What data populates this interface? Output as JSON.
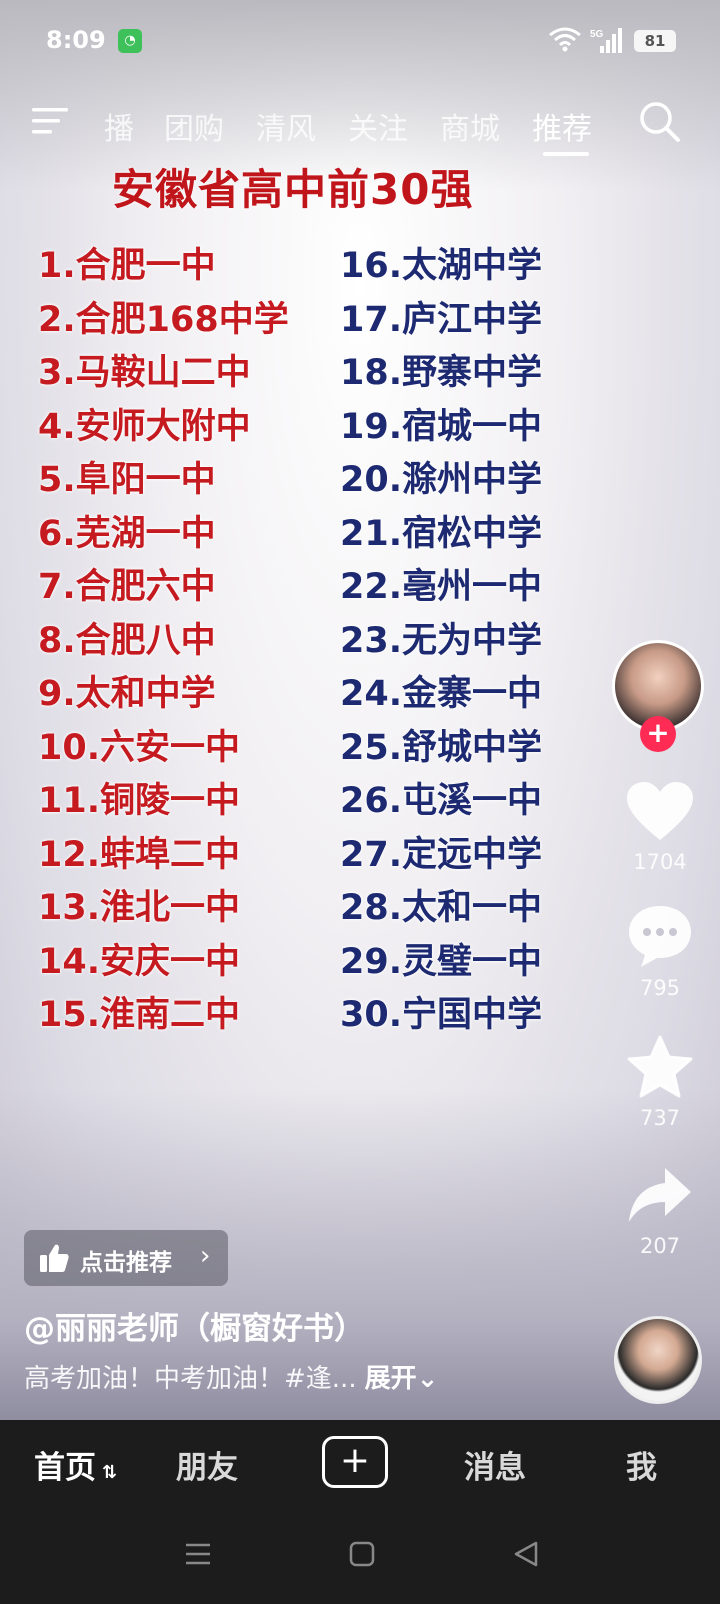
{
  "status_bar": {
    "time": "8:09",
    "network": "5G",
    "battery": "81"
  },
  "top_nav": {
    "tabs": [
      {
        "label": "播"
      },
      {
        "label": "团购"
      },
      {
        "label": "清风"
      },
      {
        "label": "关注"
      },
      {
        "label": "商城"
      },
      {
        "label": "推荐",
        "active": true
      }
    ]
  },
  "video": {
    "title": "安徽省高中前30强",
    "left_list": [
      "1.合肥一中",
      "2.合肥168中学",
      "3.马鞍山二中",
      "4.安师大附中",
      "5.阜阳一中",
      "6.芜湖一中",
      "7.合肥六中",
      "8.合肥八中",
      "9.太和中学",
      "10.六安一中",
      "11.铜陵一中",
      "12.蚌埠二中",
      "13.淮北一中",
      "14.安庆一中",
      "15.淮南二中"
    ],
    "right_list": [
      "16.太湖中学",
      "17.庐江中学",
      "18.野寨中学",
      "19.宿城一中",
      "20.滁州中学",
      "21.宿松中学",
      "22.亳州一中",
      "23.无为中学",
      "24.金寨一中",
      "25.舒城中学",
      "26.屯溪一中",
      "27.定远中学",
      "28.太和一中",
      "29.灵璧一中",
      "30.宁国中学"
    ]
  },
  "sidebar": {
    "follow": "+",
    "like_count": "1704",
    "comment_count": "795",
    "favorite_count": "737",
    "share_count": "207"
  },
  "overlay": {
    "recommend_label": "点击推荐",
    "author": "@丽丽老师（橱窗好书）",
    "caption": "高考加油！中考加油！#逢...",
    "expand": "展开"
  },
  "bottom_tabs": {
    "home": "首页",
    "friends": "朋友",
    "create": "+",
    "messages": "消息",
    "me": "我"
  },
  "colors": {
    "accent": "#fe2c55",
    "list_left": "#c41a20",
    "list_right": "#1d2a72"
  }
}
